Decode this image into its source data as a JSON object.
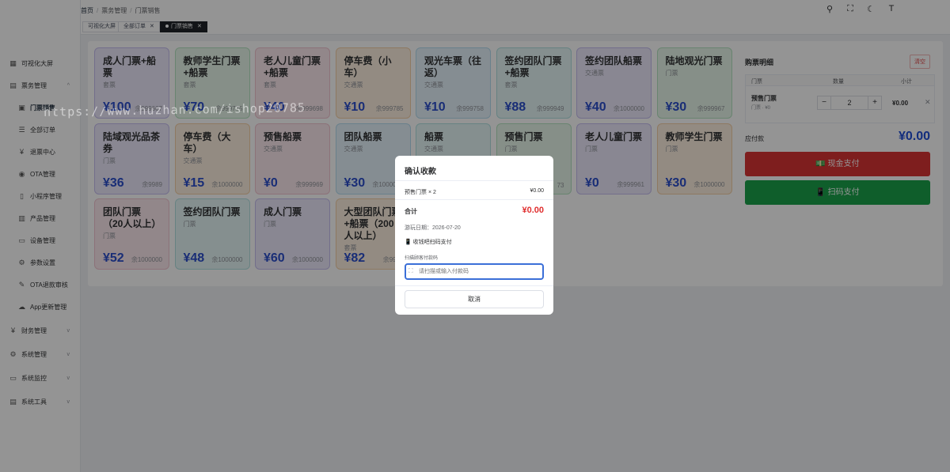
{
  "breadcrumb": [
    "首页",
    "票务管理",
    "门票销售"
  ],
  "sidebar": {
    "items": [
      {
        "icon": "▦",
        "label": "可视化大屏",
        "sub": false,
        "arrow": ""
      },
      {
        "icon": "▤",
        "label": "票务管理",
        "sub": false,
        "arrow": "^"
      },
      {
        "icon": "▣",
        "label": "门票销售",
        "sub": true,
        "arrow": "",
        "active": true
      },
      {
        "icon": "☰",
        "label": "全部订单",
        "sub": true,
        "arrow": ""
      },
      {
        "icon": "¥",
        "label": "退票中心",
        "sub": true,
        "arrow": ""
      },
      {
        "icon": "◉",
        "label": "OTA管理",
        "sub": true,
        "arrow": ""
      },
      {
        "icon": "▯",
        "label": "小程序管理",
        "sub": true,
        "arrow": ""
      },
      {
        "icon": "▥",
        "label": "产品管理",
        "sub": true,
        "arrow": ""
      },
      {
        "icon": "▭",
        "label": "设备管理",
        "sub": true,
        "arrow": ""
      },
      {
        "icon": "⚙",
        "label": "参数设置",
        "sub": true,
        "arrow": ""
      },
      {
        "icon": "✎",
        "label": "OTA退款审核",
        "sub": true,
        "arrow": ""
      },
      {
        "icon": "☁",
        "label": "App更新管理",
        "sub": true,
        "arrow": ""
      },
      {
        "icon": "¥",
        "label": "财务管理",
        "sub": false,
        "arrow": "v"
      },
      {
        "icon": "⚙",
        "label": "系统管理",
        "sub": false,
        "arrow": "v"
      },
      {
        "icon": "▭",
        "label": "系统监控",
        "sub": false,
        "arrow": "v"
      },
      {
        "icon": "▤",
        "label": "系统工具",
        "sub": false,
        "arrow": "v"
      }
    ]
  },
  "tags": [
    {
      "label": "可视化大屏",
      "active": false,
      "closable": false
    },
    {
      "label": "全部订单",
      "active": false,
      "closable": true
    },
    {
      "label": "门票销售",
      "active": true,
      "closable": true
    }
  ],
  "tickets": [
    {
      "name": "成人门票+船票",
      "type": "套票",
      "price": "¥100",
      "stock": "余999667",
      "color": "purple"
    },
    {
      "name": "教师学生门票+船票",
      "type": "套票",
      "price": "¥70",
      "stock": "余999775",
      "color": "green"
    },
    {
      "name": "老人儿童门票+船票",
      "type": "套票",
      "price": "¥40",
      "stock": "余999698",
      "color": "pink"
    },
    {
      "name": "停车费（小车）",
      "type": "交通票",
      "price": "¥10",
      "stock": "余999785",
      "color": "orange"
    },
    {
      "name": "观光车票（往返）",
      "type": "交通票",
      "price": "¥10",
      "stock": "余999758",
      "color": "blue"
    },
    {
      "name": "签约团队门票+船票",
      "type": "套票",
      "price": "¥88",
      "stock": "余999949",
      "color": "cyan"
    },
    {
      "name": "签约团队船票",
      "type": "交通票",
      "price": "¥40",
      "stock": "余1000000",
      "color": "purple"
    },
    {
      "name": "陆地观光门票",
      "type": "门票",
      "price": "¥30",
      "stock": "余999967",
      "color": "green"
    },
    {
      "name": "陆域观光品茶券",
      "type": "门票",
      "price": "¥36",
      "stock": "余9989",
      "color": "purple"
    },
    {
      "name": "停车费（大车）",
      "type": "交通票",
      "price": "¥15",
      "stock": "余1000000",
      "color": "orange"
    },
    {
      "name": "预售船票",
      "type": "交通票",
      "price": "¥0",
      "stock": "余999969",
      "color": "pink"
    },
    {
      "name": "团队船票",
      "type": "交通票",
      "price": "¥30",
      "stock": "余1000000",
      "color": "blue"
    },
    {
      "name": "船票",
      "type": "交通票",
      "price": "",
      "stock": "",
      "color": "cyan"
    },
    {
      "name": "预售门票",
      "type": "门票",
      "price": "",
      "stock": "73",
      "color": "green"
    },
    {
      "name": "老人儿童门票",
      "type": "门票",
      "price": "¥0",
      "stock": "余999961",
      "color": "purple"
    },
    {
      "name": "教师学生门票",
      "type": "门票",
      "price": "¥30",
      "stock": "余1000000",
      "color": "orange"
    },
    {
      "name": "团队门票（20人以上）",
      "type": "门票",
      "price": "¥52",
      "stock": "余1000000",
      "color": "pink"
    },
    {
      "name": "签约团队门票",
      "type": "门票",
      "price": "¥48",
      "stock": "余1000000",
      "color": "cyan"
    },
    {
      "name": "成人门票",
      "type": "门票",
      "price": "¥60",
      "stock": "余1000000",
      "color": "purple"
    },
    {
      "name": "大型团队门票+船票（200人以上）",
      "type": "套票",
      "price": "¥82",
      "stock": "余9999",
      "color": "orange"
    }
  ],
  "cart": {
    "title": "购票明细",
    "clear_label": "清空",
    "headers": {
      "ticket": "门票",
      "qty": "数量",
      "subtotal": "小计"
    },
    "row": {
      "name": "预售门票",
      "sub": "门票 · ¥0",
      "qty": "2",
      "subtotal": "¥0.00"
    },
    "due_label": "应付款",
    "due_value": "¥0.00",
    "cash_label": "💵 现金支付",
    "scan_label": "📱 扫码支付"
  },
  "modal": {
    "title": "确认收款",
    "item": "预售门票 × 2",
    "item_price": "¥0.00",
    "total_label": "合计",
    "total": "¥0.00",
    "date": "游玩日期：2026-07-20",
    "method": "📱 收钱吧扫码支付",
    "scan_label": "扫描顾客付款码",
    "input_placeholder": "请扫描或输入付款码",
    "cancel_label": "取消"
  },
  "watermark": "https://www.huzhan.com/ishop20785",
  "colors": {
    "primary_blue": "#1f4ed8",
    "cash_red": "#d93535",
    "scan_green": "#1aa34a",
    "total_red": "#e02f2f"
  }
}
